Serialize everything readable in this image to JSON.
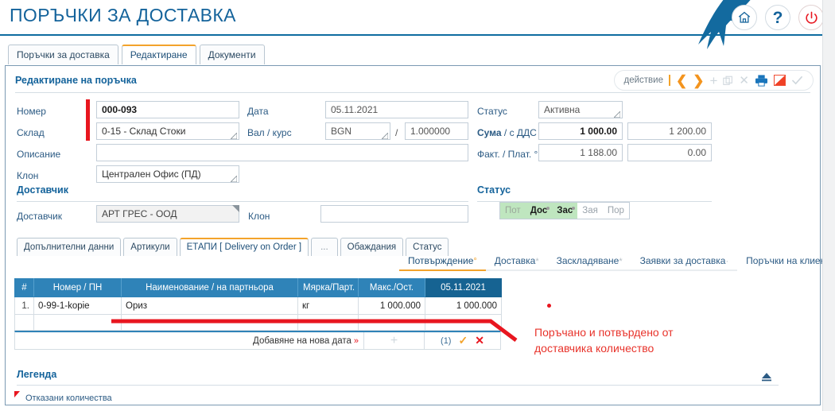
{
  "header": {
    "title": "ПОРЪЧКИ ЗА ДОСТАВКА",
    "icons": [
      {
        "name": "home-icon",
        "label": "⌂"
      },
      {
        "name": "help-icon",
        "label": "?"
      },
      {
        "name": "power-icon",
        "label": "⏻"
      }
    ],
    "accent_blue": "#14639b",
    "accent_orange": "#f3a32b",
    "accent_red": "#e8161f"
  },
  "top_tabs": [
    {
      "label": "Поръчки за доставка",
      "active": false
    },
    {
      "label": "Редактиране",
      "active": true
    },
    {
      "label": "Документи",
      "active": false
    }
  ],
  "panel": {
    "section_title": "Редактиране на поръчка",
    "supplier_section_title": "Доставчик",
    "status_section_title": "Статус"
  },
  "actionbar": {
    "label": "действие",
    "icons": [
      "prev-chevron",
      "next-chevron",
      "add-plus",
      "copy",
      "delete-x",
      "print",
      "export",
      "confirm-check"
    ]
  },
  "form": {
    "number": {
      "label": "Номер",
      "value": "000-093"
    },
    "warehouse": {
      "label": "Склад",
      "value": "0-15 - Склад Стоки"
    },
    "description": {
      "label": "Описание",
      "value": ""
    },
    "branch": {
      "label": "Клон",
      "value": "Централен Офис (ПД)"
    },
    "date": {
      "label": "Дата",
      "value": "05.11.2021"
    },
    "currency": {
      "label": "Вал / курс",
      "value": "BGN",
      "rate": "1.000000",
      "separator": "/"
    },
    "status": {
      "label": "Статус",
      "value": "Активна"
    },
    "sum": {
      "label_bold": "Сума",
      "label_rest": "/ с ДДС °",
      "value": "1 000.00",
      "value_vat": "1 200.00"
    },
    "fact": {
      "label": "Факт. / Плат. °",
      "value": "1 188.00",
      "value_paid": "0.00"
    },
    "supplier": {
      "label": "Доставчик",
      "value": "АРТ ГРЕС - ООД"
    },
    "supplier_branch": {
      "label": "Клон",
      "value": ""
    }
  },
  "status_chips": [
    {
      "label": "Пот",
      "state": "pale",
      "dot": false
    },
    {
      "label": "Дос",
      "state": "on",
      "dot": true
    },
    {
      "label": "Зас",
      "state": "on",
      "dot": true
    },
    {
      "label": "Зая",
      "state": "off",
      "dot": false
    },
    {
      "label": "Пор",
      "state": "off",
      "dot": false
    }
  ],
  "section_tabs": [
    {
      "label": "Допълнителни данни",
      "active": false
    },
    {
      "label": "Артикули",
      "active": false
    },
    {
      "label": "ЕТАПИ [ Delivery on Order ]",
      "active": true
    },
    {
      "label": "...",
      "active": false
    },
    {
      "label": "Обаждания",
      "active": false
    },
    {
      "label": "Статус",
      "active": false
    }
  ],
  "sub_nav": [
    {
      "label": "Потвърждение",
      "marker": "°",
      "marker_style": "orange",
      "active": true
    },
    {
      "label": "Доставка",
      "marker": "*",
      "marker_style": "grey",
      "active": false
    },
    {
      "label": "Заскладяване",
      "marker": "*",
      "marker_style": "grey",
      "active": false
    },
    {
      "label": "Заявки за доставка",
      "marker": "·",
      "marker_style": "grey",
      "active": false
    },
    {
      "label": "Поръчки на клиенти",
      "marker": "·",
      "marker_style": "grey",
      "active": false
    }
  ],
  "table": {
    "headers": [
      "#",
      "Номер / ПН",
      "Наименование / на партньора",
      "Мярка/Парт.",
      "Макс./Ост.",
      "05.11.2021"
    ],
    "rows": [
      {
        "index": "1.",
        "number": "0-99-1-kopie",
        "name": "Ориз",
        "unit": "кг",
        "max": "1 000.000",
        "qty": "1 000.000"
      }
    ],
    "footer": {
      "add_label": "Добавяне на нова дата",
      "add_chevron": "»",
      "plus": "+",
      "count": "(1)",
      "confirm": "✓",
      "cancel": "✕"
    }
  },
  "annotation": {
    "line1": "Поръчано и потвърдено от",
    "line2": "доставчика количество",
    "color": "#e8332b"
  },
  "legend": {
    "title": "Легенда",
    "items": [
      {
        "label": "Отказани количества",
        "marker_color": "#e8161f"
      }
    ],
    "collapse_icon": "collapse-up-icon"
  }
}
